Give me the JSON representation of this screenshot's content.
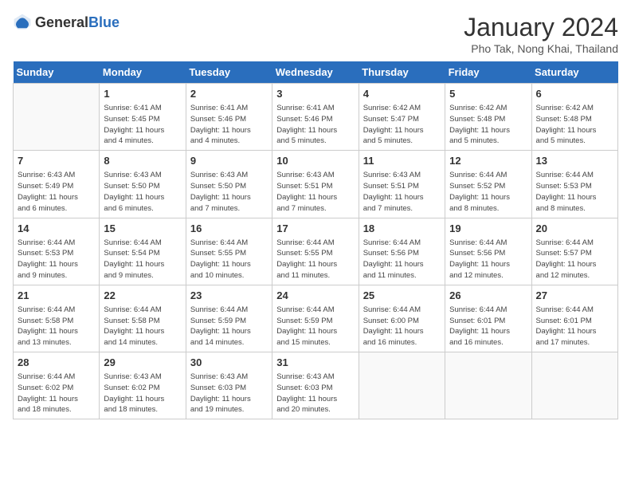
{
  "header": {
    "logo_general": "General",
    "logo_blue": "Blue",
    "month_title": "January 2024",
    "location": "Pho Tak, Nong Khai, Thailand"
  },
  "days_of_week": [
    "Sunday",
    "Monday",
    "Tuesday",
    "Wednesday",
    "Thursday",
    "Friday",
    "Saturday"
  ],
  "weeks": [
    [
      {
        "day": "",
        "info": ""
      },
      {
        "day": "1",
        "info": "Sunrise: 6:41 AM\nSunset: 5:45 PM\nDaylight: 11 hours\nand 4 minutes."
      },
      {
        "day": "2",
        "info": "Sunrise: 6:41 AM\nSunset: 5:46 PM\nDaylight: 11 hours\nand 4 minutes."
      },
      {
        "day": "3",
        "info": "Sunrise: 6:41 AM\nSunset: 5:46 PM\nDaylight: 11 hours\nand 5 minutes."
      },
      {
        "day": "4",
        "info": "Sunrise: 6:42 AM\nSunset: 5:47 PM\nDaylight: 11 hours\nand 5 minutes."
      },
      {
        "day": "5",
        "info": "Sunrise: 6:42 AM\nSunset: 5:48 PM\nDaylight: 11 hours\nand 5 minutes."
      },
      {
        "day": "6",
        "info": "Sunrise: 6:42 AM\nSunset: 5:48 PM\nDaylight: 11 hours\nand 5 minutes."
      }
    ],
    [
      {
        "day": "7",
        "info": "Sunrise: 6:43 AM\nSunset: 5:49 PM\nDaylight: 11 hours\nand 6 minutes."
      },
      {
        "day": "8",
        "info": "Sunrise: 6:43 AM\nSunset: 5:50 PM\nDaylight: 11 hours\nand 6 minutes."
      },
      {
        "day": "9",
        "info": "Sunrise: 6:43 AM\nSunset: 5:50 PM\nDaylight: 11 hours\nand 7 minutes."
      },
      {
        "day": "10",
        "info": "Sunrise: 6:43 AM\nSunset: 5:51 PM\nDaylight: 11 hours\nand 7 minutes."
      },
      {
        "day": "11",
        "info": "Sunrise: 6:43 AM\nSunset: 5:51 PM\nDaylight: 11 hours\nand 7 minutes."
      },
      {
        "day": "12",
        "info": "Sunrise: 6:44 AM\nSunset: 5:52 PM\nDaylight: 11 hours\nand 8 minutes."
      },
      {
        "day": "13",
        "info": "Sunrise: 6:44 AM\nSunset: 5:53 PM\nDaylight: 11 hours\nand 8 minutes."
      }
    ],
    [
      {
        "day": "14",
        "info": "Sunrise: 6:44 AM\nSunset: 5:53 PM\nDaylight: 11 hours\nand 9 minutes."
      },
      {
        "day": "15",
        "info": "Sunrise: 6:44 AM\nSunset: 5:54 PM\nDaylight: 11 hours\nand 9 minutes."
      },
      {
        "day": "16",
        "info": "Sunrise: 6:44 AM\nSunset: 5:55 PM\nDaylight: 11 hours\nand 10 minutes."
      },
      {
        "day": "17",
        "info": "Sunrise: 6:44 AM\nSunset: 5:55 PM\nDaylight: 11 hours\nand 11 minutes."
      },
      {
        "day": "18",
        "info": "Sunrise: 6:44 AM\nSunset: 5:56 PM\nDaylight: 11 hours\nand 11 minutes."
      },
      {
        "day": "19",
        "info": "Sunrise: 6:44 AM\nSunset: 5:56 PM\nDaylight: 11 hours\nand 12 minutes."
      },
      {
        "day": "20",
        "info": "Sunrise: 6:44 AM\nSunset: 5:57 PM\nDaylight: 11 hours\nand 12 minutes."
      }
    ],
    [
      {
        "day": "21",
        "info": "Sunrise: 6:44 AM\nSunset: 5:58 PM\nDaylight: 11 hours\nand 13 minutes."
      },
      {
        "day": "22",
        "info": "Sunrise: 6:44 AM\nSunset: 5:58 PM\nDaylight: 11 hours\nand 14 minutes."
      },
      {
        "day": "23",
        "info": "Sunrise: 6:44 AM\nSunset: 5:59 PM\nDaylight: 11 hours\nand 14 minutes."
      },
      {
        "day": "24",
        "info": "Sunrise: 6:44 AM\nSunset: 5:59 PM\nDaylight: 11 hours\nand 15 minutes."
      },
      {
        "day": "25",
        "info": "Sunrise: 6:44 AM\nSunset: 6:00 PM\nDaylight: 11 hours\nand 16 minutes."
      },
      {
        "day": "26",
        "info": "Sunrise: 6:44 AM\nSunset: 6:01 PM\nDaylight: 11 hours\nand 16 minutes."
      },
      {
        "day": "27",
        "info": "Sunrise: 6:44 AM\nSunset: 6:01 PM\nDaylight: 11 hours\nand 17 minutes."
      }
    ],
    [
      {
        "day": "28",
        "info": "Sunrise: 6:44 AM\nSunset: 6:02 PM\nDaylight: 11 hours\nand 18 minutes."
      },
      {
        "day": "29",
        "info": "Sunrise: 6:43 AM\nSunset: 6:02 PM\nDaylight: 11 hours\nand 18 minutes."
      },
      {
        "day": "30",
        "info": "Sunrise: 6:43 AM\nSunset: 6:03 PM\nDaylight: 11 hours\nand 19 minutes."
      },
      {
        "day": "31",
        "info": "Sunrise: 6:43 AM\nSunset: 6:03 PM\nDaylight: 11 hours\nand 20 minutes."
      },
      {
        "day": "",
        "info": ""
      },
      {
        "day": "",
        "info": ""
      },
      {
        "day": "",
        "info": ""
      }
    ]
  ]
}
